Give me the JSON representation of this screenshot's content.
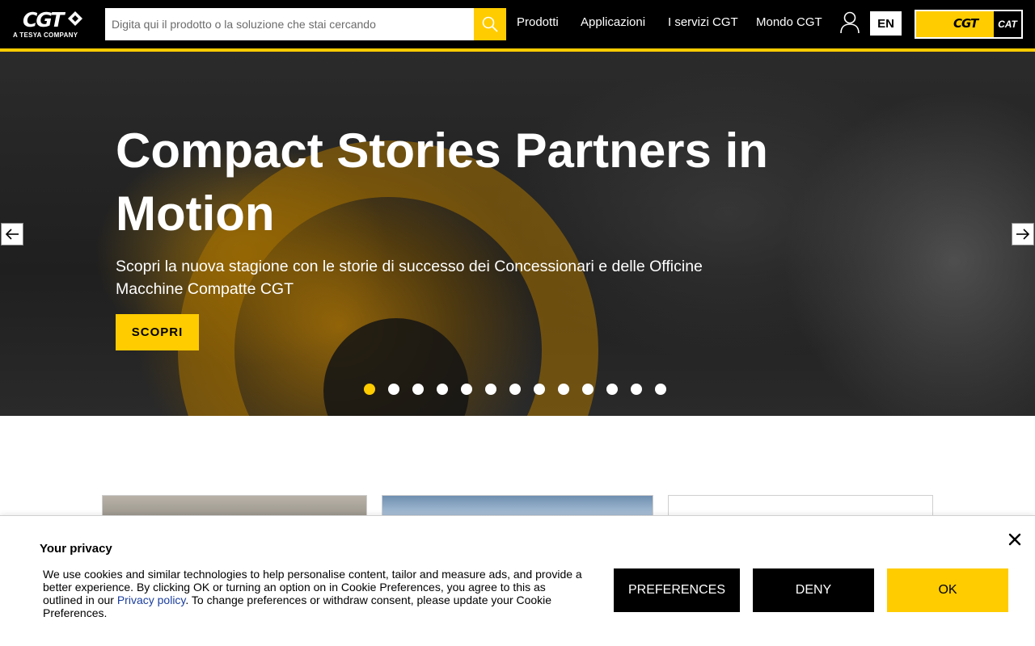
{
  "header": {
    "logo": {
      "main": "CGT",
      "sub": "A TESYA COMPANY"
    },
    "search": {
      "placeholder": "Digita qui il prodotto o la soluzione che stai cercando",
      "icon": "search-icon"
    },
    "nav": [
      "Prodotti",
      "Applicazioni",
      "I servizi CGT",
      "Mondo CGT"
    ],
    "user_icon": "user-icon",
    "language": "EN",
    "partner_logo": {
      "cgt": "CGT",
      "cat": "CAT"
    }
  },
  "hero": {
    "title": "Compact Stories Partners in Motion",
    "subtitle": "Scopri la nuova stagione con le storie di successo dei Concessionari e delle Officine Macchine Compatte CGT",
    "cta": "SCOPRI",
    "slide_count": 13,
    "active_slide": 1
  },
  "cookie": {
    "title": "Your privacy",
    "text_before_link": "We use cookies and similar technologies to help personalise content, tailor and measure ads, and provide a better experience. By clicking OK or turning an option on in Cookie Preferences, you agree to this as outlined in our ",
    "link": "Privacy policy",
    "text_after_link": ". To change preferences or withdraw consent, please update your Cookie Preferences.",
    "buttons": {
      "preferences": "PREFERENCES",
      "deny": "DENY",
      "ok": "OK"
    }
  },
  "colors": {
    "brand_yellow": "#ffcc00",
    "header_bg": "#000000",
    "link_blue": "#1a3e9e"
  }
}
